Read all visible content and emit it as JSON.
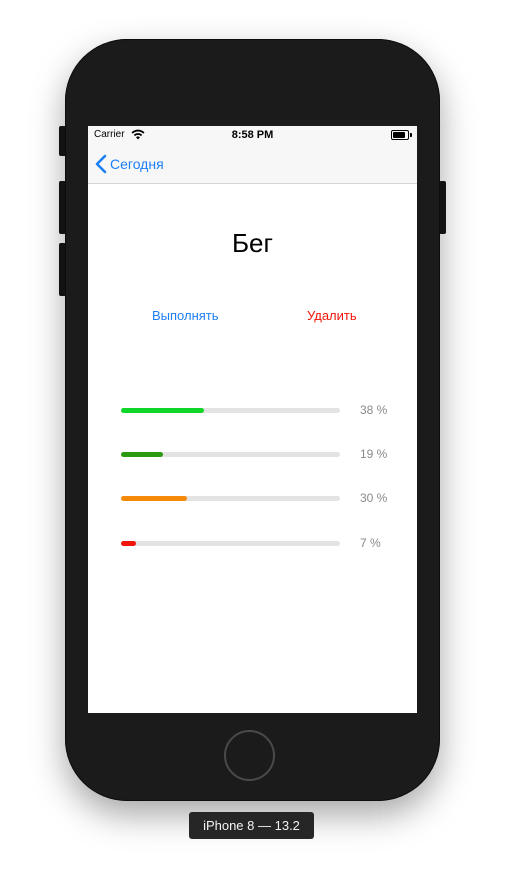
{
  "statusbar": {
    "carrier": "Carrier",
    "time": "8:58 PM"
  },
  "navbar": {
    "back_label": "Сегодня"
  },
  "main": {
    "title": "Бег",
    "perform_label": "Выполнять",
    "delete_label": "Удалить",
    "stats": [
      {
        "percent_label": "38 %",
        "value": 0.38,
        "color": "#11d62a"
      },
      {
        "percent_label": "19 %",
        "value": 0.19,
        "color": "#2b9a11"
      },
      {
        "percent_label": "30 %",
        "value": 0.3,
        "color": "#f58a0a"
      },
      {
        "percent_label": "7 %",
        "value": 0.07,
        "color": "#f0160b"
      }
    ]
  },
  "simulator": {
    "device_label": "iPhone 8 — 13.2"
  },
  "colors": {
    "accent": "#1e7ff5",
    "destructive": "#f0160b"
  }
}
